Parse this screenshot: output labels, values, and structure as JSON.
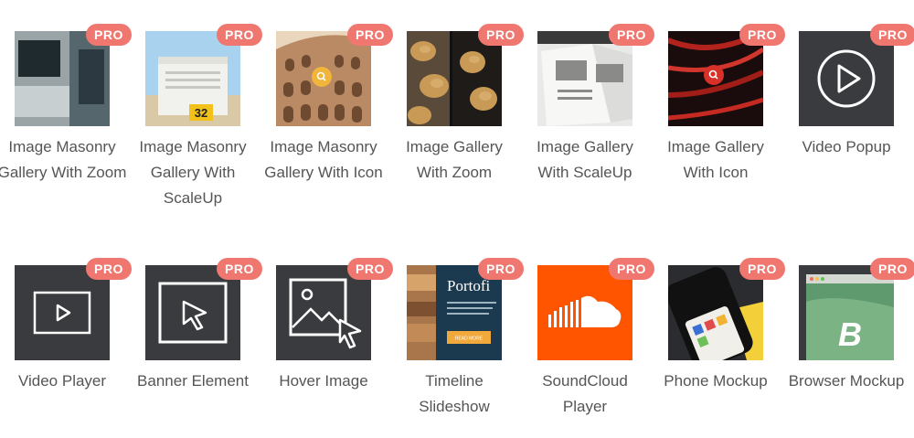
{
  "badge": "PRO",
  "row1": [
    {
      "label": "Image Masonry Gallery With Zoom"
    },
    {
      "label": "Image Masonry Gallery With ScaleUp"
    },
    {
      "label": "Image Masonry Gallery With Icon"
    },
    {
      "label": "Image Gallery With Zoom"
    },
    {
      "label": "Image Gallery With ScaleUp"
    },
    {
      "label": "Image Gallery With Icon"
    },
    {
      "label": "Video Popup"
    }
  ],
  "row2": [
    {
      "label": "Video Player"
    },
    {
      "label": "Banner Element"
    },
    {
      "label": "Hover Image"
    },
    {
      "label": "Timeline Slideshow"
    },
    {
      "label": "SoundCloud Player"
    },
    {
      "label": "Phone Mockup"
    },
    {
      "label": "Browser Mockup"
    }
  ],
  "thumb_text": {
    "lifeguard_number": "32",
    "timeline_title": "Portofi",
    "timeline_button": "READ MORE",
    "browser_logo": "B"
  },
  "colors": {
    "badge": "#ef7770",
    "label": "#555555",
    "dark_tile": "#3a3b3f",
    "soundcloud": "#ff5500"
  },
  "icons": [
    "play-circle-icon",
    "play-icon",
    "cursor-icon",
    "image-icon",
    "soundcloud-icon",
    "search-icon"
  ]
}
